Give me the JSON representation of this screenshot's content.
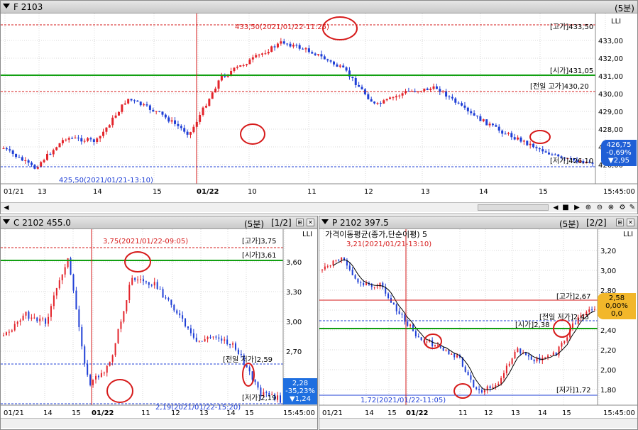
{
  "top": {
    "title": "F 2103",
    "period": "(5분)",
    "scale_icon": "LLI",
    "marks": {
      "high": "433,50(2021/01/22-11:25)",
      "low": "425,50(2021/01/21-13:10)",
      "label_high": "[고가]433,50",
      "label_open": "[시가]431,05",
      "label_prevhigh": "[전일 고가]430,20",
      "label_low": "[저가]426,10"
    },
    "yticks": [
      "433,00",
      "432,00",
      "431,00",
      "430,00",
      "429,00",
      "428,00",
      "427,00",
      "426,00"
    ],
    "xticks": [
      "01/21",
      "13",
      "14",
      "15",
      "01/22",
      "10",
      "11",
      "12",
      "13",
      "14",
      "15",
      "15:45:00"
    ],
    "badge": {
      "price": "426,75",
      "pct": "-0,69%",
      "chg": "▼2,95",
      "color": "#1f5fd6"
    }
  },
  "left": {
    "title": "C 2102 455.0",
    "period": "(5분)",
    "page": "[1/2]",
    "marks": {
      "high": "3,75(2021/01/22-09:05)",
      "low": "2,19(2021/01/22-15:20)",
      "label_high": "[고가]3,75",
      "label_open": "[시가]3,61",
      "label_prev": "[전일 저가]2,59",
      "label_low": "[저가]2,19"
    },
    "yticks": [
      "3,60",
      "3,30",
      "3,00",
      "2,70"
    ],
    "xticks": [
      "01/21",
      "14",
      "15",
      "01/22",
      "11",
      "12",
      "13",
      "14",
      "15",
      "15:45:00"
    ],
    "badge": {
      "price": "2,28",
      "pct": "-35,23%",
      "chg": "▼1,24",
      "color": "#1f6fe0"
    }
  },
  "right": {
    "title": "P 2102 397.5",
    "period": "(5분)",
    "page": "[2/2]",
    "legend": "가격이동평균(종가,단순이평) 5",
    "marks": {
      "high": "3,21(2021/01/21-13:10)",
      "low": "1,72(2021/01/22-11:05)",
      "label_high": "[고가]2,67",
      "label_open": "[시가]2,38",
      "label_prev": "[전일 저가]2,43",
      "label_low": "[저가]1,72"
    },
    "yticks": [
      "3,20",
      "3,00",
      "2,80",
      "2,60",
      "2,40",
      "2,20",
      "2,00",
      "1,80"
    ],
    "xticks": [
      "01/21",
      "14",
      "15",
      "01/22",
      "11",
      "12",
      "13",
      "14",
      "15",
      "15:45:00"
    ],
    "badge": {
      "price": "2,58",
      "pct": "0,00%",
      "chg": "0,0",
      "color": "#f2b72a"
    }
  },
  "colors": {
    "up": "#e3242b",
    "down": "#1f3fd6",
    "open_line": "#12a012",
    "ma": "#000000",
    "grid": "#d9d9d9"
  },
  "icons": [
    "chevron-down-icon",
    "settings-icon",
    "close-icon",
    "scroll-left-icon",
    "scroll-right-icon",
    "play-icon",
    "stop-icon",
    "zoom-in-icon",
    "zoom-out-icon",
    "zoom-reset-icon",
    "wrench-icon"
  ]
}
